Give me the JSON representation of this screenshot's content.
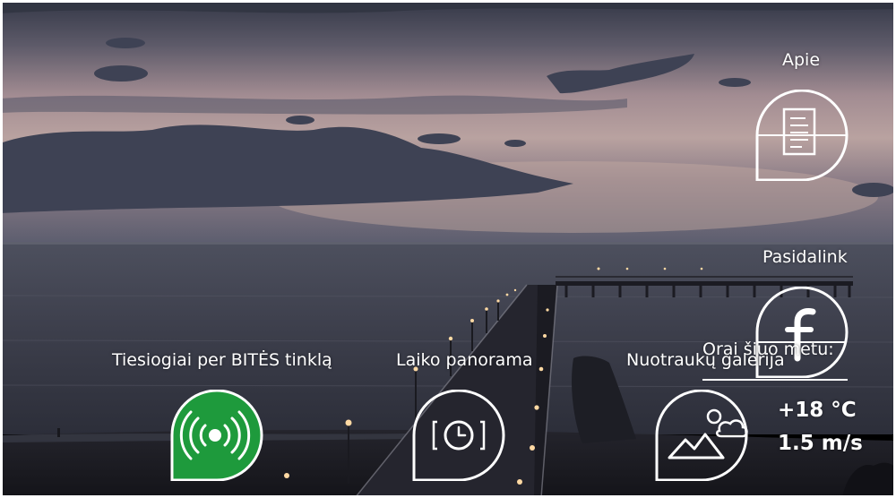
{
  "menu": {
    "apie": {
      "label": "Apie",
      "icon": "document-icon"
    },
    "pasidalink": {
      "label": "Pasidalink",
      "icon": "facebook-icon"
    },
    "live": {
      "label": "Tiesiogiai per BITĖS tinklą",
      "icon": "broadcast-icon"
    },
    "timelapse": {
      "label": "Laiko panorama",
      "icon": "clock-icon"
    },
    "gallery": {
      "label": "Nuotraukų galerija",
      "icon": "landscape-photo-icon"
    }
  },
  "weather": {
    "title": "Orai šiuo metu:",
    "temperature": "+18 °C",
    "wind": "1.5 m/s"
  },
  "colors": {
    "accent_green": "#1e9a3c",
    "ui_white": "#ffffff"
  }
}
